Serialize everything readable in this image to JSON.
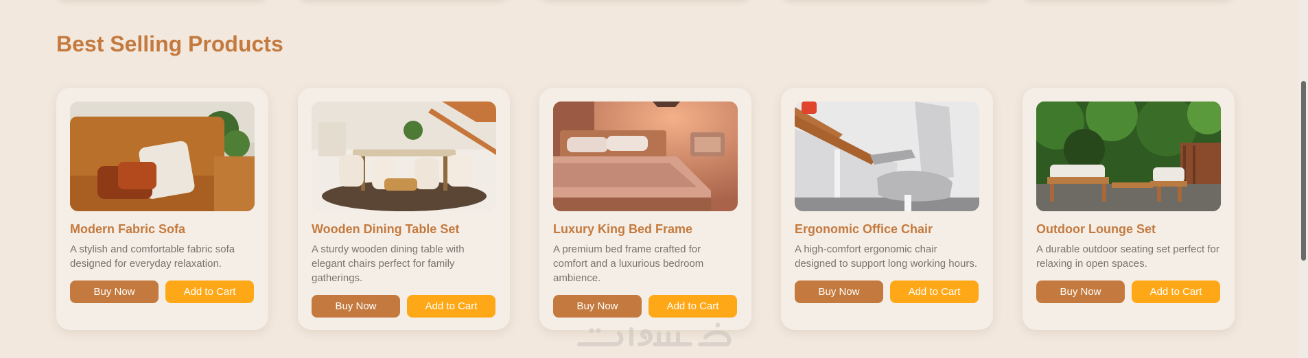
{
  "section": {
    "title": "Best Selling Products"
  },
  "products": [
    {
      "title": "Modern Fabric Sofa",
      "description": "A stylish and comfortable fabric sofa designed for everyday relaxation.",
      "buy_label": "Buy Now",
      "cart_label": "Add to Cart"
    },
    {
      "title": "Wooden Dining Table Set",
      "description": "A sturdy wooden dining table with elegant chairs perfect for family gatherings.",
      "buy_label": "Buy Now",
      "cart_label": "Add to Cart"
    },
    {
      "title": "Luxury King Bed Frame",
      "description": "A premium bed frame crafted for comfort and a luxurious bedroom ambience.",
      "buy_label": "Buy Now",
      "cart_label": "Add to Cart"
    },
    {
      "title": "Ergonomic Office Chair",
      "description": "A high-comfort ergonomic chair designed to support long working hours.",
      "buy_label": "Buy Now",
      "cart_label": "Add to Cart"
    },
    {
      "title": "Outdoor Lounge Set",
      "description": "A durable outdoor seating set perfect for relaxing in open spaces.",
      "buy_label": "Buy Now",
      "cart_label": "Add to Cart"
    }
  ],
  "watermark": {
    "text": "خمسات"
  },
  "colors": {
    "background": "#f2e8de",
    "accent": "#c47a3e",
    "cart_button": "#ffa817",
    "card": "#f5eee7"
  }
}
